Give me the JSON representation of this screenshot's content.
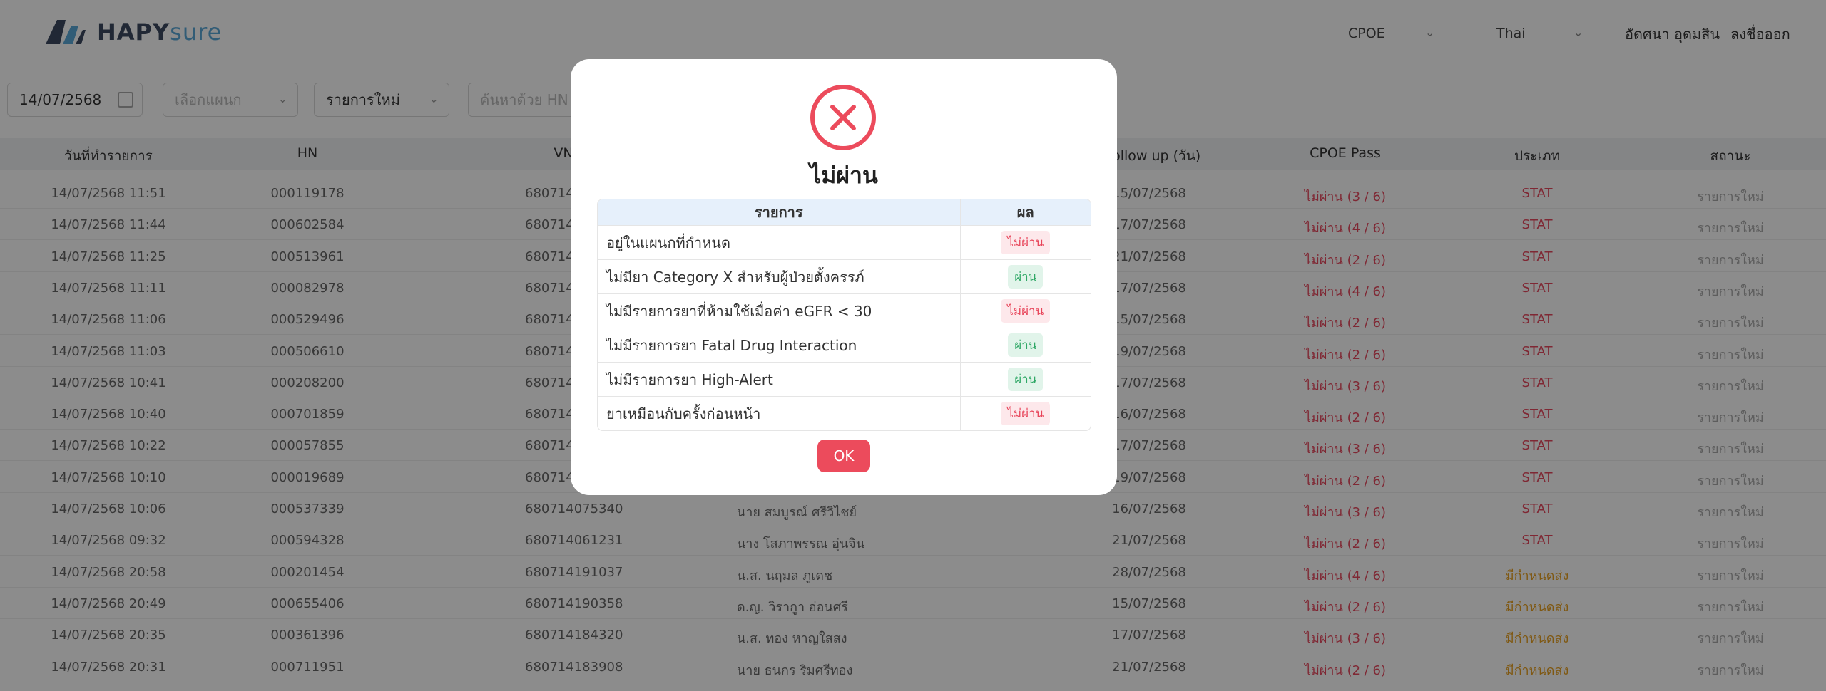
{
  "header": {
    "logo_hapy": "HAPY",
    "logo_sure": "sure",
    "module_select": "CPOE",
    "language_select": "Thai",
    "user_name": "อัดศนา อุดมสิน",
    "logout_label": "ลงชื่อออก"
  },
  "filters": {
    "date_value": "14/07/2568",
    "dept_placeholder": "เลือกแผนก",
    "status_value": "รายการใหม่",
    "search_placeholder": "ค้นหาด้วย HN"
  },
  "table": {
    "columns": [
      "วันที่ทำรายการ",
      "HN",
      "VN",
      "Follow up (วัน)",
      "CPOE Pass",
      "ประเภท",
      "สถานะ"
    ],
    "rows": [
      {
        "date": "14/07/2568 11:51",
        "hn": "000119178",
        "vn": "68071400",
        "name": "",
        "followup": "15/07/2568",
        "cpoe": "ไม่ผ่าน (3 / 6)",
        "type": "STAT",
        "status": "รายการใหม่"
      },
      {
        "date": "14/07/2568 11:44",
        "hn": "000602584",
        "vn": "68071400",
        "name": "",
        "followup": "17/07/2568",
        "cpoe": "ไม่ผ่าน (4 / 6)",
        "type": "STAT",
        "status": "รายการใหม่"
      },
      {
        "date": "14/07/2568 11:25",
        "hn": "000513961",
        "vn": "68071400",
        "name": "",
        "followup": "21/07/2568",
        "cpoe": "ไม่ผ่าน (2 / 6)",
        "type": "STAT",
        "status": "รายการใหม่"
      },
      {
        "date": "14/07/2568 11:11",
        "hn": "000082978",
        "vn": "68071400",
        "name": "",
        "followup": "17/07/2568",
        "cpoe": "ไม่ผ่าน (4 / 6)",
        "type": "STAT",
        "status": "รายการใหม่"
      },
      {
        "date": "14/07/2568 11:06",
        "hn": "000529496",
        "vn": "68071400",
        "name": "",
        "followup": "15/07/2568",
        "cpoe": "ไม่ผ่าน (2 / 6)",
        "type": "STAT",
        "status": "รายการใหม่"
      },
      {
        "date": "14/07/2568 11:03",
        "hn": "000506610",
        "vn": "68071400",
        "name": "",
        "followup": "19/07/2568",
        "cpoe": "ไม่ผ่าน (2 / 6)",
        "type": "STAT",
        "status": "รายการใหม่"
      },
      {
        "date": "14/07/2568 10:41",
        "hn": "000208200",
        "vn": "68071400",
        "name": "",
        "followup": "17/07/2568",
        "cpoe": "ไม่ผ่าน (3 / 6)",
        "type": "STAT",
        "status": "รายการใหม่"
      },
      {
        "date": "14/07/2568 10:40",
        "hn": "000701859",
        "vn": "68071400",
        "name": "",
        "followup": "16/07/2568",
        "cpoe": "ไม่ผ่าน (2 / 6)",
        "type": "STAT",
        "status": "รายการใหม่"
      },
      {
        "date": "14/07/2568 10:22",
        "hn": "000057855",
        "vn": "68071400",
        "name": "",
        "followup": "17/07/2568",
        "cpoe": "ไม่ผ่าน (3 / 6)",
        "type": "STAT",
        "status": "รายการใหม่"
      },
      {
        "date": "14/07/2568 10:10",
        "hn": "000019689",
        "vn": "68071400",
        "name": "",
        "followup": "19/07/2568",
        "cpoe": "ไม่ผ่าน (2 / 6)",
        "type": "STAT",
        "status": "รายการใหม่"
      },
      {
        "date": "14/07/2568 10:06",
        "hn": "000537339",
        "vn": "680714075340",
        "name": "นาย สมบูรณ์ ศรีวิไชย์",
        "followup": "16/07/2568",
        "cpoe": "ไม่ผ่าน (3 / 6)",
        "type": "STAT",
        "status": "รายการใหม่"
      },
      {
        "date": "14/07/2568 09:32",
        "hn": "000594328",
        "vn": "680714061231",
        "name": "นาง โสภาพรรณ อุ่นจิน",
        "followup": "21/07/2568",
        "cpoe": "ไม่ผ่าน (2 / 6)",
        "type": "STAT",
        "status": "รายการใหม่"
      },
      {
        "date": "14/07/2568 20:58",
        "hn": "000201454",
        "vn": "680714191037",
        "name": "น.ส. นฤมล ภูเดช",
        "followup": "28/07/2568",
        "cpoe": "ไม่ผ่าน (4 / 6)",
        "type": "มีกำหนดส่ง",
        "status": "รายการใหม่"
      },
      {
        "date": "14/07/2568 20:49",
        "hn": "000655406",
        "vn": "680714190358",
        "name": "ด.ญ. วิรากูา อ่อนศรี",
        "followup": "15/07/2568",
        "cpoe": "ไม่ผ่าน (2 / 6)",
        "type": "มีกำหนดส่ง",
        "status": "รายการใหม่"
      },
      {
        "date": "14/07/2568 20:35",
        "hn": "000361396",
        "vn": "680714184320",
        "name": "น.ส. ทอง หาญใสสง",
        "followup": "17/07/2568",
        "cpoe": "ไม่ผ่าน (3 / 6)",
        "type": "มีกำหนดส่ง",
        "status": "รายการใหม่"
      },
      {
        "date": "14/07/2568 20:31",
        "hn": "000711951",
        "vn": "680714183908",
        "name": "นาย ธนกร ริมศรีทอง",
        "followup": "21/07/2568",
        "cpoe": "ไม่ผ่าน (2 / 6)",
        "type": "มีกำหนดส่ง",
        "status": "รายการใหม่"
      }
    ]
  },
  "modal": {
    "title": "ไม่ผ่าน",
    "col_item": "รายการ",
    "col_result": "ผล",
    "rows": [
      {
        "item": "อยู่ในแผนกที่กำหนด",
        "result": "ไม่ผ่าน",
        "pass": false
      },
      {
        "item": "ไม่มียา Category X สำหรับผู้ป่วยตั้งครรภ์",
        "result": "ผ่าน",
        "pass": true
      },
      {
        "item": "ไม่มีรายการยาที่ห้ามใช้เมื่อค่า eGFR < 30",
        "result": "ไม่ผ่าน",
        "pass": false
      },
      {
        "item": "ไม่มีรายการยา Fatal Drug Interaction",
        "result": "ผ่าน",
        "pass": true
      },
      {
        "item": "ไม่มีรายการยา High-Alert",
        "result": "ผ่าน",
        "pass": true
      },
      {
        "item": "ยาเหมือนกับครั้งก่อนหน้า",
        "result": "ไม่ผ่าน",
        "pass": false
      }
    ],
    "ok_label": "OK"
  },
  "colors": {
    "danger": "#ec4b5c",
    "success": "#2fa866",
    "warning": "#e8a020"
  }
}
